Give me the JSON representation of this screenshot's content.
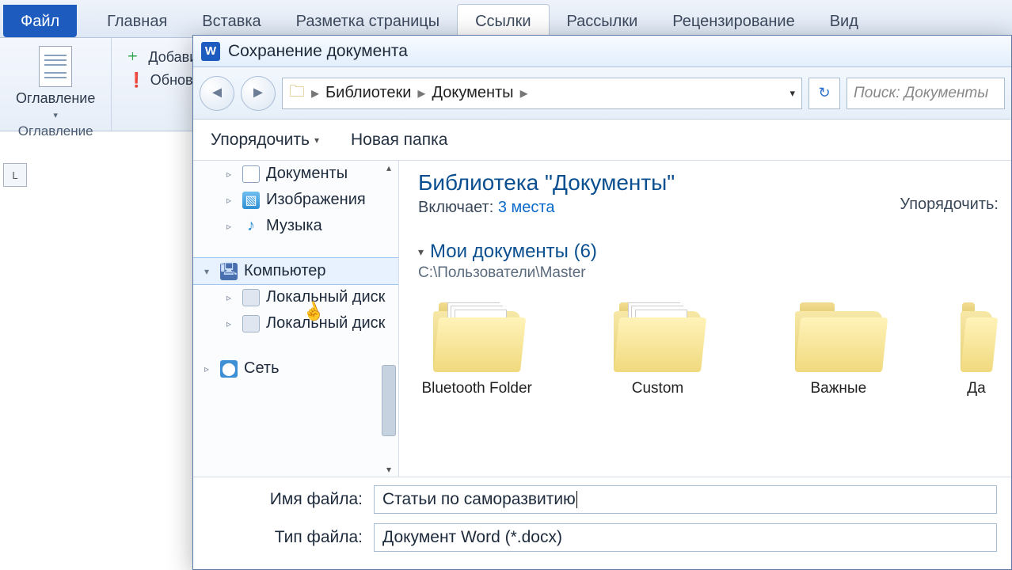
{
  "ribbon": {
    "tabs": [
      "Файл",
      "Главная",
      "Вставка",
      "Разметка страницы",
      "Ссылки",
      "Рассылки",
      "Рецензирование",
      "Вид"
    ],
    "active_tab_index": 4,
    "toc_group": {
      "button_label": "Оглавление",
      "group_label": "Оглавление"
    },
    "actions": {
      "add": "Добавить",
      "update": "Обновить"
    }
  },
  "ruler_corner": "L",
  "dialog": {
    "title": "Сохранение документа",
    "breadcrumb": [
      "Библиотеки",
      "Документы"
    ],
    "search_placeholder": "Поиск: Документы",
    "toolbar": {
      "organize": "Упорядочить",
      "new_folder": "Новая папка"
    },
    "tree": {
      "items": [
        {
          "label": "Документы",
          "icon": "doc",
          "child": true
        },
        {
          "label": "Изображения",
          "icon": "pic",
          "child": true
        },
        {
          "label": "Музыка",
          "icon": "music",
          "child": true
        }
      ],
      "computer": {
        "label": "Компьютер",
        "children": [
          "Локальный диск",
          "Локальный диск"
        ]
      },
      "network": {
        "label": "Сеть"
      }
    },
    "view": {
      "library_title": "Библиотека \"Документы\"",
      "includes_label": "Включает:",
      "includes_count": "3 места",
      "arrange_label": "Упорядочить:",
      "section": {
        "title": "Мои документы (6)",
        "path": "C:\\Пользователи\\Master"
      },
      "folders": [
        "Bluetooth Folder",
        "Custom",
        "Важные",
        "Да"
      ]
    },
    "fields": {
      "filename_label": "Имя файла:",
      "filename_value": "Статьи по саморазвитию",
      "filetype_label": "Тип файла:",
      "filetype_value": "Документ Word (*.docx)"
    }
  }
}
